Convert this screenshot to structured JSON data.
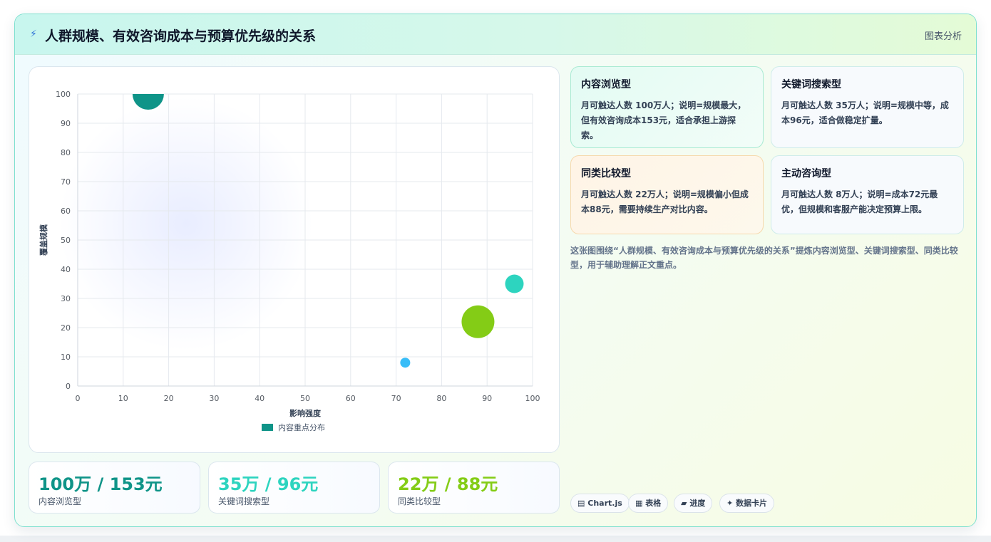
{
  "header": {
    "icon": "lightning-icon",
    "title": "人群规模、有效咨询成本与预算优先级的关系",
    "tag": "图表分析"
  },
  "chart_data": {
    "type": "bubble",
    "xlabel": "影响强度",
    "ylabel": "覆盖规模",
    "xlim": [
      0,
      100
    ],
    "ylim": [
      0,
      100
    ],
    "x_ticks": [
      "0",
      "10",
      "20",
      "30",
      "40",
      "50",
      "60",
      "70",
      "80",
      "90",
      "100"
    ],
    "y_ticks": [
      "0",
      "10",
      "20",
      "30",
      "40",
      "50",
      "60",
      "70",
      "80",
      "90",
      "100"
    ],
    "grid": true,
    "legend": {
      "position": "bottom",
      "entries": [
        "内容重点分布"
      ]
    },
    "series": [
      {
        "name": "内容重点分布",
        "points": [
          {
            "label": "内容浏览型",
            "x": 15.5,
            "y": 100,
            "r": 22,
            "color": "#0f9488"
          },
          {
            "label": "关键词搜索型",
            "x": 96,
            "y": 35,
            "r": 13,
            "color": "#2dd4bf"
          },
          {
            "label": "同类比较型",
            "x": 88,
            "y": 22,
            "r": 23,
            "color": "#84cc16"
          },
          {
            "label": "主动咨询型",
            "x": 72,
            "y": 8,
            "r": 7,
            "color": "#38bdf8"
          }
        ]
      }
    ]
  },
  "stats": [
    {
      "value": "100万 / 153元",
      "label": "内容浏览型",
      "color": "#0f9488"
    },
    {
      "value": "35万 / 96元",
      "label": "关键词搜索型",
      "color": "#2dd4bf"
    },
    {
      "value": "22万 / 88元",
      "label": "同类比较型",
      "color": "#84cc16"
    }
  ],
  "info_cards": [
    {
      "title": "内容浏览型",
      "text": "月可触达人数 100万人；说明=规模最大，但有效咨询成本153元，适合承担上游探索。"
    },
    {
      "title": "关键词搜索型",
      "text": "月可触达人数 35万人；说明=规模中等，成本96元，适合做稳定扩量。"
    },
    {
      "title": "同类比较型",
      "text": "月可触达人数 22万人；说明=规模偏小但成本88元，需要持续生产对比内容。"
    },
    {
      "title": "主动咨询型",
      "text": "月可触达人数 8万人；说明=成本72元最优，但规模和客服产能决定预算上限。"
    }
  ],
  "summary": "这张图围绕“人群规模、有效咨询成本与预算优先级的关系”提炼内容浏览型、关键词搜索型、同类比较型，用于辅助理解正文重点。",
  "tags": [
    {
      "icon": "chart-icon",
      "glyph": "▤",
      "label": "Chart.js"
    },
    {
      "icon": "table-icon",
      "glyph": "▦",
      "label": "表格"
    },
    {
      "icon": "progress-icon",
      "glyph": "▰",
      "label": "进度"
    },
    {
      "icon": "sparkle-icon",
      "glyph": "✦",
      "label": "数据卡片"
    }
  ]
}
